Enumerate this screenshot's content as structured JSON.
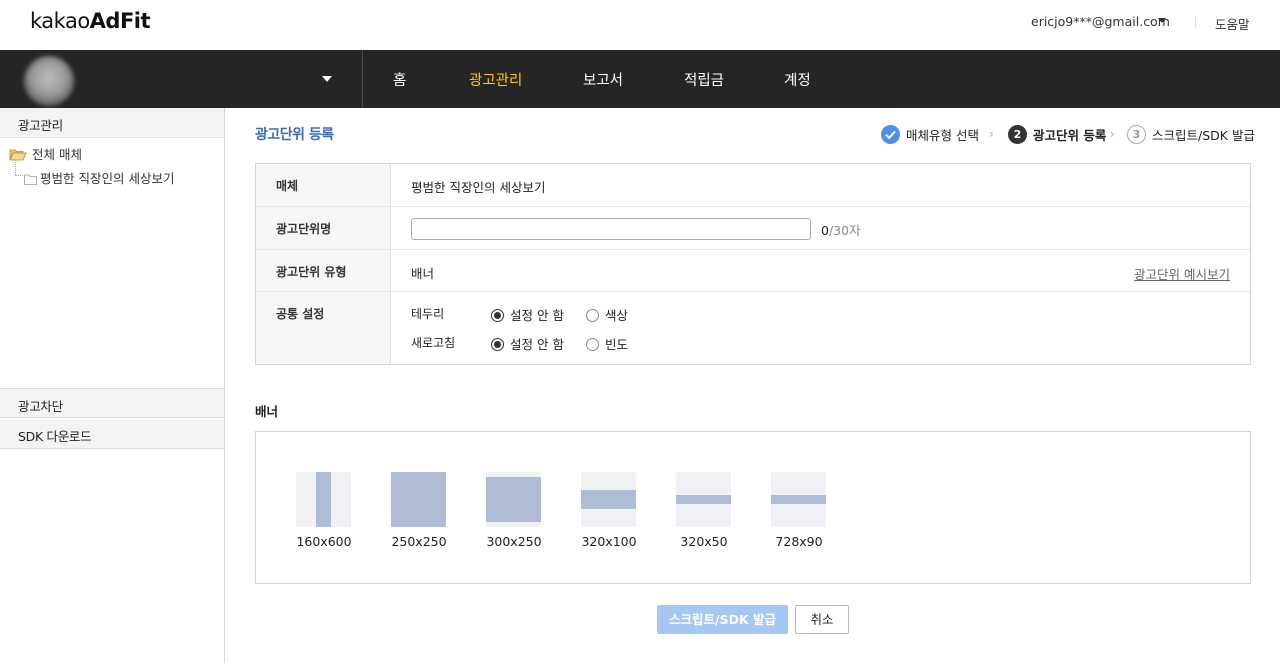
{
  "header": {
    "logo_light": "kakao",
    "logo_bold": "AdFit",
    "user_email": "ericjo9***@gmail.com",
    "help_label": "도움말"
  },
  "nav": {
    "items": [
      {
        "label": "홈",
        "active": false
      },
      {
        "label": "광고관리",
        "active": true
      },
      {
        "label": "보고서",
        "active": false
      },
      {
        "label": "적립금",
        "active": false
      },
      {
        "label": "계정",
        "active": false
      }
    ],
    "active_color": "#ffcd00"
  },
  "sidebar": {
    "section_ad_management": "광고관리",
    "tree_root": "전체 매체",
    "tree_child": "평범한 직장인의 세상보기",
    "section_ad_block": "광고차단",
    "section_sdk_download": "SDK 다운로드"
  },
  "page": {
    "title": "광고단위 등록",
    "steps": [
      {
        "label": "매체유형 선택",
        "state": "done"
      },
      {
        "number": "2",
        "label": "광고단위 등록",
        "state": "current"
      },
      {
        "number": "3",
        "label": "스크립트/SDK 발급",
        "state": "todo"
      }
    ]
  },
  "form": {
    "media_label": "매체",
    "media_value": "평범한 직장인의 세상보기",
    "unit_name_label": "광고단위명",
    "unit_name_value": "",
    "char_count": "0",
    "char_max": "/30자",
    "unit_type_label": "광고단위 유형",
    "unit_type_value": "배너",
    "preview_link": "광고단위 예시보기",
    "common_settings_label": "공통 설정",
    "border_label": "테두리",
    "border_options": [
      "설정 안 함",
      "색상"
    ],
    "border_selected": "설정 안 함",
    "refresh_label": "새로고침",
    "refresh_options": [
      "설정 안 함",
      "빈도"
    ],
    "refresh_selected": "설정 안 함"
  },
  "banner": {
    "heading": "배너",
    "sizes": [
      "160x600",
      "250x250",
      "300x250",
      "320x100",
      "320x50",
      "728x90"
    ]
  },
  "buttons": {
    "issue": "스크립트/SDK 발급",
    "cancel": "취소"
  },
  "colors": {
    "navbar_bg": "#252525",
    "title_blue": "#3d6cb5",
    "step_done": "#4e8fe8",
    "issue_button": "#a4c8f2",
    "thumb_fill": "#afbcd6"
  }
}
